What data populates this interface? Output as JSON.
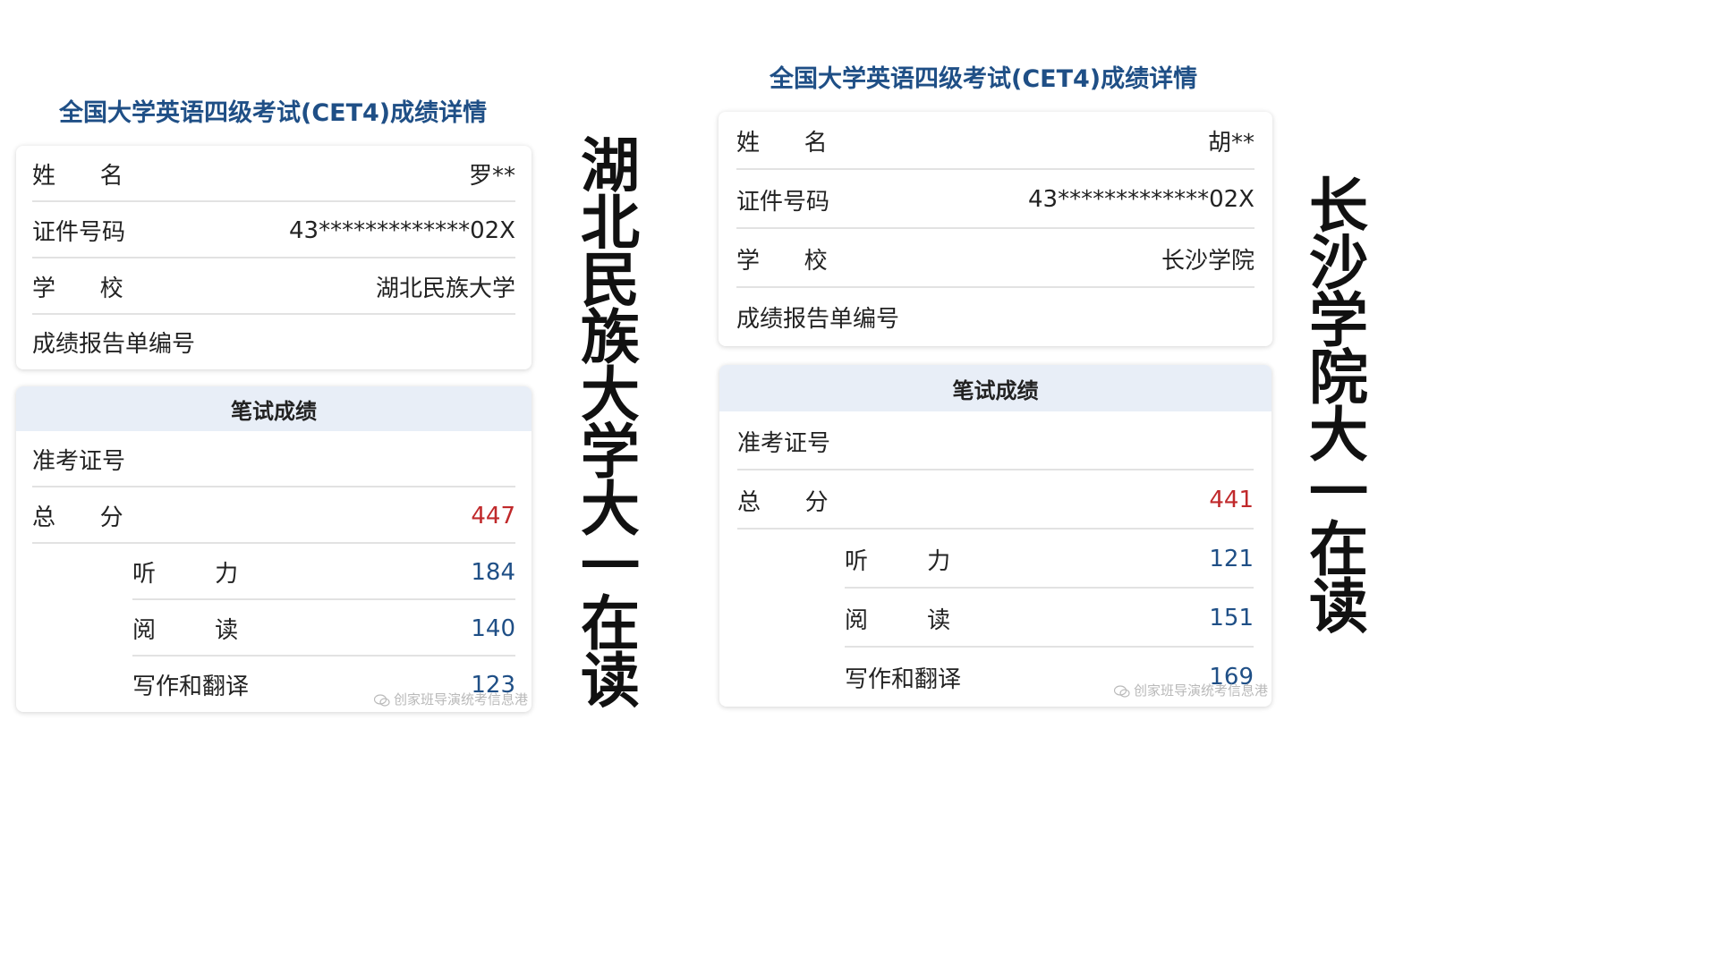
{
  "left": {
    "title": "全国大学英语四级考试(CET4)成绩详情",
    "info": {
      "name_label": "姓      名",
      "name_value": "罗**",
      "id_label": "证件号码",
      "id_value": "43*************02X",
      "school_label": "学      校",
      "school_value": "湖北民族大学",
      "report_label": "成绩报告单编号",
      "report_value": ""
    },
    "score": {
      "header": "笔试成绩",
      "ticket_label": "准考证号",
      "ticket_value": "",
      "total_label": "总      分",
      "total_value": "447",
      "listening_label": "听        力",
      "listening_value": "184",
      "reading_label": "阅        读",
      "reading_value": "140",
      "writing_label": "写作和翻译",
      "writing_value": "123"
    },
    "caption": "湖北民族大学大一在读",
    "watermark": "创家班导演统考信息港"
  },
  "right": {
    "title": "全国大学英语四级考试(CET4)成绩详情",
    "info": {
      "name_label": "姓      名",
      "name_value": "胡**",
      "id_label": "证件号码",
      "id_value": "43*************02X",
      "school_label": "学      校",
      "school_value": "长沙学院",
      "report_label": "成绩报告单编号",
      "report_value": ""
    },
    "score": {
      "header": "笔试成绩",
      "ticket_label": "准考证号",
      "ticket_value": "",
      "total_label": "总      分",
      "total_value": "441",
      "listening_label": "听        力",
      "listening_value": "121",
      "reading_label": "阅        读",
      "reading_value": "151",
      "writing_label": "写作和翻译",
      "writing_value": "169"
    },
    "caption": "长沙学院大一在读",
    "watermark": "创家班导演统考信息港"
  },
  "colors": {
    "title": "#1f4f86",
    "total": "#c0292b",
    "subscore": "#1f4f86",
    "header_bg": "#e8eef7"
  }
}
